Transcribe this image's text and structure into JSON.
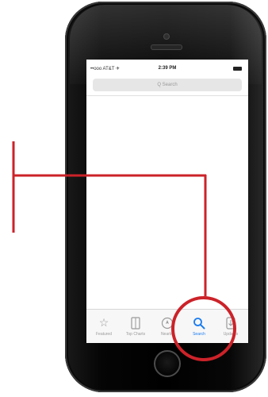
{
  "status_bar": {
    "carrier": "••ooo AT&T ✈",
    "time": "2:39 PM"
  },
  "search": {
    "placeholder": "Q  Search"
  },
  "tab_bar": {
    "active_tab": "Search",
    "tabs": [
      {
        "label": "Featured",
        "icon": "star-icon"
      },
      {
        "label": "Top Charts",
        "icon": "list-icon"
      },
      {
        "label": "Nearby",
        "icon": "compass-icon"
      },
      {
        "label": "Search",
        "icon": "search-icon"
      },
      {
        "label": "Updates",
        "icon": "download-icon"
      }
    ]
  },
  "annotation": {
    "color": "#cc2229"
  }
}
